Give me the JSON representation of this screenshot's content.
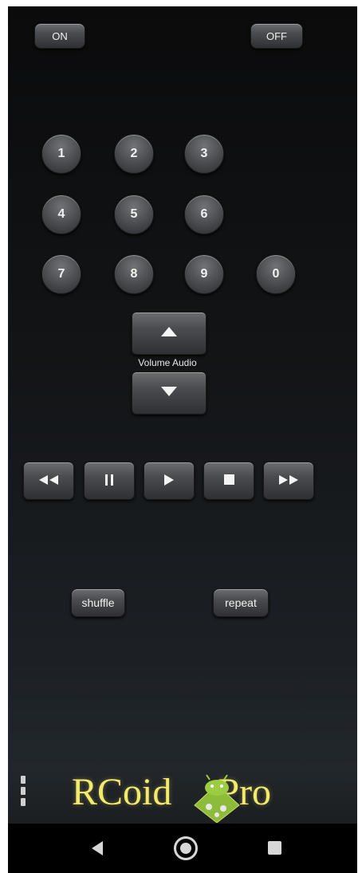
{
  "power": {
    "on_label": "ON",
    "off_label": "OFF"
  },
  "numpad": {
    "keys": [
      "1",
      "2",
      "3",
      "4",
      "5",
      "6",
      "7",
      "8",
      "9",
      "0"
    ]
  },
  "volume": {
    "label": "Volume Audio",
    "up_icon": "triangle-up-icon",
    "down_icon": "triangle-down-icon"
  },
  "transport": {
    "rewind_icon": "rewind-icon",
    "pause_icon": "pause-icon",
    "play_icon": "play-icon",
    "stop_icon": "stop-icon",
    "forward_icon": "fast-forward-icon"
  },
  "mode": {
    "shuffle_label": "shuffle",
    "repeat_label": "repeat"
  },
  "brand": {
    "left": "RCoid",
    "right": "Pro"
  },
  "navbar": {
    "back_icon": "back-triangle-icon",
    "home_icon": "home-circle-icon",
    "recents_icon": "recents-square-icon"
  },
  "colors": {
    "logo": "#f2ea6a",
    "background": "#121416",
    "button": "#4a4c4f"
  }
}
